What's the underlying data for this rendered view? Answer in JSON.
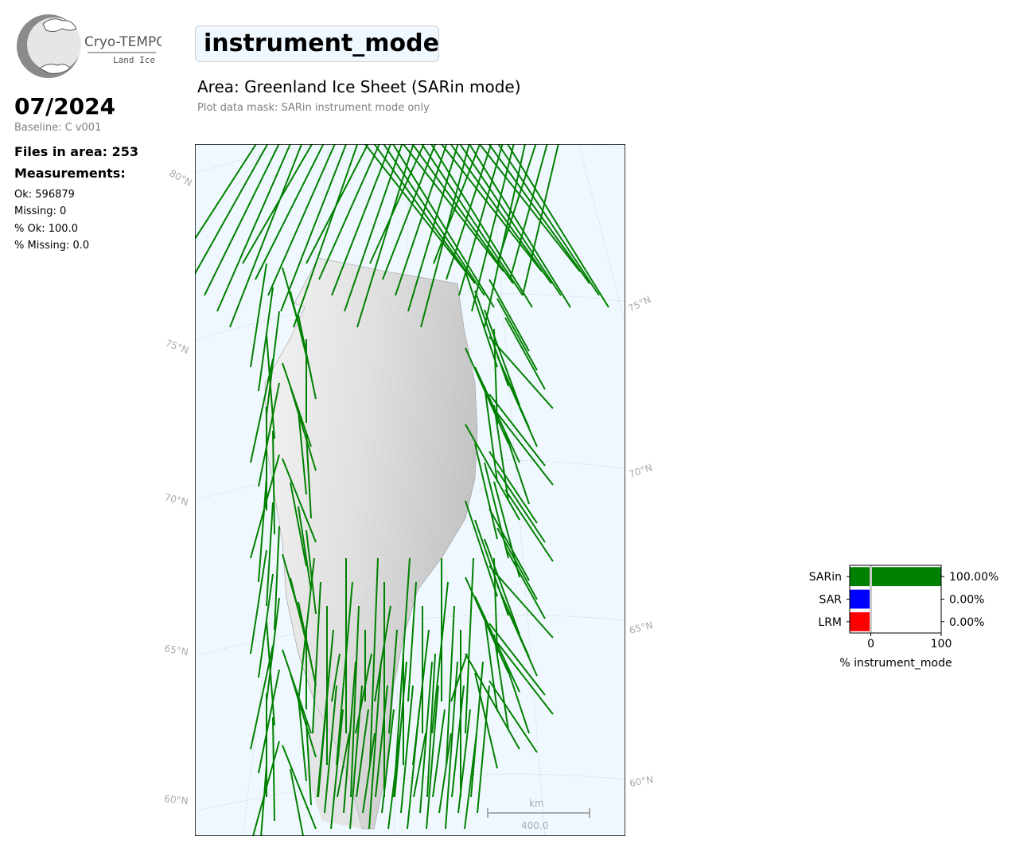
{
  "logo": {
    "name": "Cryo-TEMPO",
    "subtitle": "Land Ice"
  },
  "sidebar": {
    "date": "07/2024",
    "baseline": "Baseline: C v001",
    "files": "Files in area: 253",
    "measurements_title": "Measurements:",
    "stats": [
      "Ok: 596879",
      "Missing: 0",
      "% Ok: 100.0",
      "% Missing: 0.0"
    ]
  },
  "header": {
    "parameter": "instrument_mode",
    "area_title": "Area: Greenland Ice Sheet (SARin mode)",
    "mask_note": "Plot data mask: SARin instrument mode only"
  },
  "map": {
    "lat_labels_left": [
      "80°N",
      "75°N",
      "70°N",
      "65°N",
      "60°N"
    ],
    "lat_labels_right": [
      "75°N",
      "70°N",
      "65°N",
      "60°N"
    ],
    "scale_bar": {
      "unit": "km",
      "value": "400.0"
    },
    "colors": {
      "ocean": "#f0f8ff",
      "track": "#008000"
    }
  },
  "chart_data": {
    "type": "bar",
    "orientation": "horizontal",
    "categories": [
      "SARin",
      "SAR",
      "LRM"
    ],
    "values": [
      100.0,
      0.0,
      0.0
    ],
    "value_labels": [
      "100.00%",
      "0.00%",
      "0.00%"
    ],
    "colors": [
      "#008000",
      "#0000ff",
      "#ff0000"
    ],
    "xlabel": "% instrument_mode",
    "xticks": [
      "0",
      "100"
    ],
    "xlim": [
      -30,
      100
    ]
  }
}
